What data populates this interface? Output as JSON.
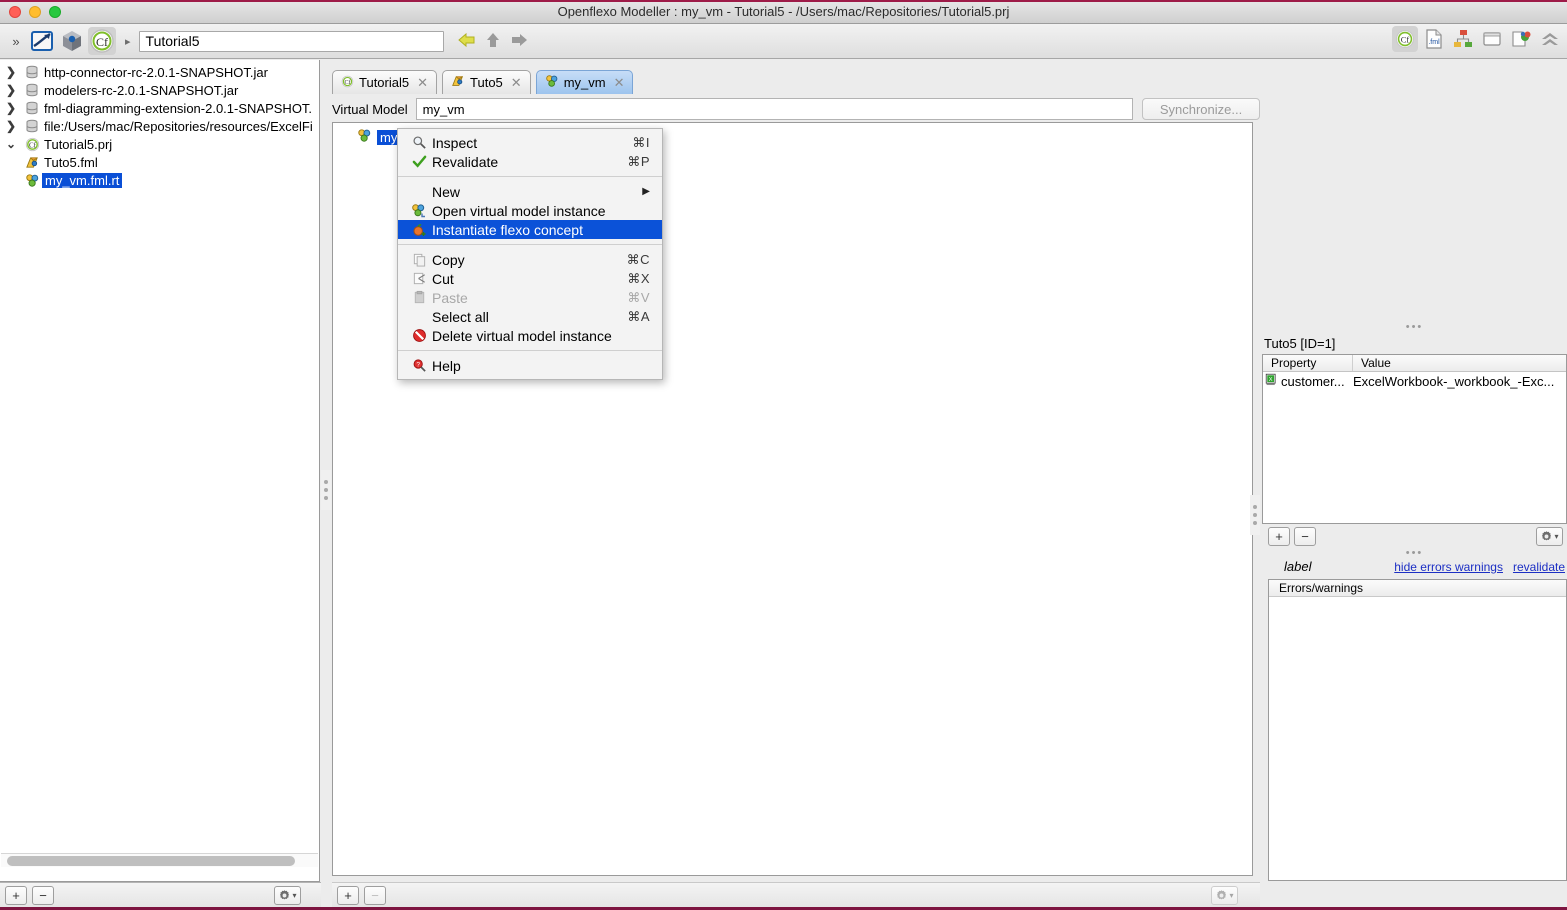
{
  "window": {
    "title": "Openflexo Modeller : my_vm - Tutorial5 - /Users/mac/Repositories/Tutorial5.prj",
    "traffic": {
      "close": "close-window",
      "minimize": "minimize-window",
      "zoom": "zoom-window"
    }
  },
  "toolbar": {
    "path_value": "Tutorial5",
    "chevron": "»",
    "separator": "▸",
    "icons": [
      {
        "name": "openflexo-logo-icon",
        "glyph": ""
      },
      {
        "name": "cube-modeller-icon",
        "glyph": ""
      },
      {
        "name": "openflexo-project-icon",
        "glyph": "Cf"
      }
    ],
    "nav": [
      {
        "name": "back-arrow-icon",
        "glyph": "⇦"
      },
      {
        "name": "up-arrow-icon",
        "glyph": "⇧"
      },
      {
        "name": "forward-arrow-icon",
        "glyph": "⇨"
      }
    ],
    "right_icons": [
      {
        "name": "project-perspective-icon",
        "label": "Cf"
      },
      {
        "name": "fml-perspective-icon",
        "label": ".fml"
      },
      {
        "name": "diagram-perspective-icon",
        "label": ""
      },
      {
        "name": "view-perspective-icon",
        "label": ""
      },
      {
        "name": "documentation-perspective-icon",
        "label": ""
      },
      {
        "name": "collapse-toolbar-icon",
        "label": ""
      }
    ]
  },
  "browser": {
    "nodes": [
      {
        "twist": "❯",
        "icon": "jar-icon",
        "label": "http-connector-rc-2.0.1-SNAPSHOT.jar",
        "selected": false,
        "indent": 0
      },
      {
        "twist": "❯",
        "icon": "jar-icon",
        "label": "modelers-rc-2.0.1-SNAPSHOT.jar",
        "selected": false,
        "indent": 0
      },
      {
        "twist": "❯",
        "icon": "jar-icon",
        "label": "fml-diagramming-extension-2.0.1-SNAPSHOT.",
        "selected": false,
        "indent": 0
      },
      {
        "twist": "❯",
        "icon": "jar-icon",
        "label": "file:/Users/mac/Repositories/resources/ExcelFi",
        "selected": false,
        "indent": 0
      },
      {
        "twist": "⌄",
        "icon": "project-icon",
        "label": "Tutorial5.prj",
        "selected": false,
        "indent": 0
      },
      {
        "twist": "",
        "icon": "fml-file-icon",
        "label": "Tuto5.fml",
        "selected": false,
        "indent": 1
      },
      {
        "twist": "",
        "icon": "vmi-icon",
        "label": "my_vm.fml.rt",
        "selected": true,
        "indent": 1
      }
    ],
    "bottom_buttons": [
      {
        "name": "add-button",
        "label": "+"
      },
      {
        "name": "remove-button",
        "label": "−"
      },
      {
        "name": "settings-gear-button",
        "label": "⚙"
      }
    ]
  },
  "center": {
    "tabs": [
      {
        "label": "Tutorial5",
        "icon": "project-icon",
        "active": false,
        "close": "✕"
      },
      {
        "label": "Tuto5",
        "icon": "fml-file-icon",
        "active": false,
        "close": "✕"
      },
      {
        "label": "my_vm",
        "icon": "vmi-icon",
        "active": true,
        "close": "✕"
      }
    ],
    "virtual_model_label": "Virtual Model",
    "virtual_model_value": "my_vm",
    "synchronize_label": "Synchronize...",
    "canvas_node_label": "my_vm",
    "bottom_buttons": [
      {
        "name": "add-button",
        "label": "+"
      },
      {
        "name": "remove-button",
        "label": "−"
      },
      {
        "name": "settings-gear-button",
        "label": "⚙"
      }
    ]
  },
  "context_menu": {
    "items": [
      {
        "icon": "magnifier-icon",
        "label": "Inspect",
        "accel": "⌘I",
        "state": "normal",
        "submenu": false
      },
      {
        "icon": "green-check-icon",
        "label": "Revalidate",
        "accel": "⌘P",
        "state": "normal",
        "submenu": false
      },
      {
        "separator": true
      },
      {
        "icon": "",
        "label": "New",
        "accel": "",
        "state": "normal",
        "submenu": true
      },
      {
        "icon": "vmi-open-icon",
        "label": "Open virtual model instance",
        "accel": "",
        "state": "normal",
        "submenu": false
      },
      {
        "icon": "flexo-concept-icon",
        "label": "Instantiate flexo concept",
        "accel": "",
        "state": "highlighted",
        "submenu": false
      },
      {
        "separator": true
      },
      {
        "icon": "copy-icon",
        "label": "Copy",
        "accel": "⌘C",
        "state": "normal",
        "submenu": false
      },
      {
        "icon": "cut-icon",
        "label": "Cut",
        "accel": "⌘X",
        "state": "normal",
        "submenu": false
      },
      {
        "icon": "paste-icon",
        "label": "Paste",
        "accel": "⌘V",
        "state": "disabled",
        "submenu": false
      },
      {
        "icon": "",
        "label": "Select all",
        "accel": "⌘A",
        "state": "normal",
        "submenu": false
      },
      {
        "icon": "delete-icon",
        "label": "Delete virtual model instance",
        "accel": "",
        "state": "normal",
        "submenu": false
      },
      {
        "separator": true
      },
      {
        "icon": "help-icon",
        "label": "Help",
        "accel": "",
        "state": "normal",
        "submenu": false
      }
    ]
  },
  "right_panel": {
    "inspector_title": "Tuto5 [ID=1]",
    "table": {
      "columns": [
        "Property",
        "Value"
      ],
      "rows": [
        {
          "icon": "excel-icon",
          "property": "customer...",
          "value": "ExcelWorkbook-_workbook_-Exc..."
        }
      ]
    },
    "toolbar_buttons": [
      {
        "name": "add-button",
        "label": "+"
      },
      {
        "name": "remove-button",
        "label": "−"
      },
      {
        "name": "settings-gear-button",
        "label": "⚙"
      }
    ],
    "label_row": {
      "label": "label",
      "links": [
        {
          "name": "hide-errors-warnings-link",
          "text": "hide errors warnings"
        },
        {
          "name": "revalidate-link",
          "text": "revalidate"
        }
      ]
    },
    "errors_header": "Errors/warnings"
  },
  "colors": {
    "selection_blue": "#0a4fd6",
    "menu_highlight": "#0b52d8",
    "active_tab": "#9dc4ee",
    "accent_magenta": "#9e1b48",
    "link_blue": "#1c2fc4"
  }
}
